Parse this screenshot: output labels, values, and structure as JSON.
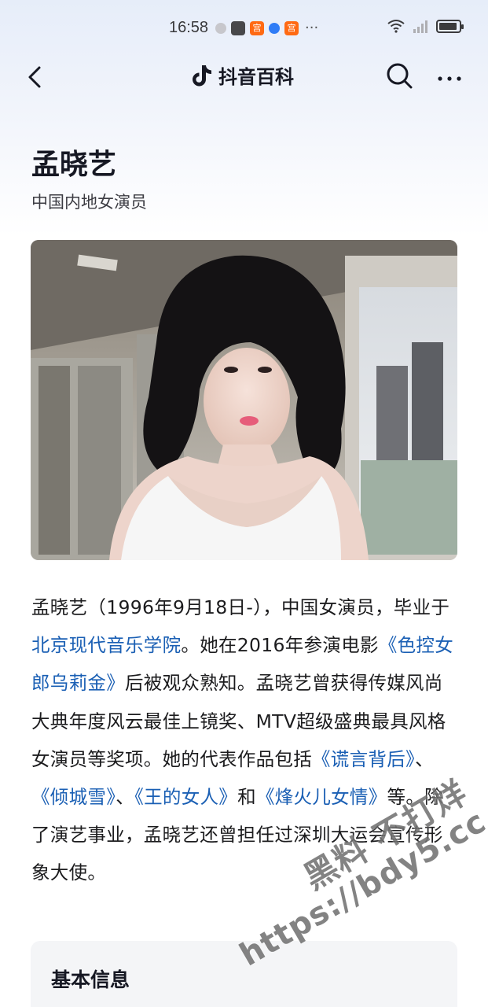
{
  "status_bar": {
    "time": "16:58",
    "more": "···"
  },
  "nav": {
    "brand": "抖音百科"
  },
  "entry": {
    "title": "孟晓艺",
    "subtitle": "中国内地女演员"
  },
  "intro": {
    "segments": [
      {
        "text": "孟晓艺（1996年9月18日-），中国女演员，毕业于",
        "link": false
      },
      {
        "text": "北京现代音乐学院",
        "link": true
      },
      {
        "text": "。她在2016年参演电影",
        "link": false
      },
      {
        "text": "《色控女郎乌莉金》",
        "link": true
      },
      {
        "text": "后被观众熟知。孟晓艺曾获得传媒风尚大典年度风云最佳上镜奖、MTV超级盛典最具风格女演员等奖项。她的代表作品包括",
        "link": false
      },
      {
        "text": "《谎言背后》",
        "link": true
      },
      {
        "text": "、",
        "link": false
      },
      {
        "text": "《倾城雪》",
        "link": true
      },
      {
        "text": "、",
        "link": false
      },
      {
        "text": "《王的女人》",
        "link": true
      },
      {
        "text": "和",
        "link": false
      },
      {
        "text": "《烽火儿女情》",
        "link": true
      },
      {
        "text": "等。除了演艺事业，孟晓艺还曾担任过深圳大运会宣传形象大使。",
        "link": false
      }
    ]
  },
  "info_card": {
    "title": "基本信息"
  },
  "watermark": {
    "line1": "黑料 不打烊",
    "line2": "https://bdy5.cc"
  },
  "colors": {
    "link": "#1a5fb4",
    "accent_brand": "#161823",
    "status_orange": "#ff6a13"
  }
}
